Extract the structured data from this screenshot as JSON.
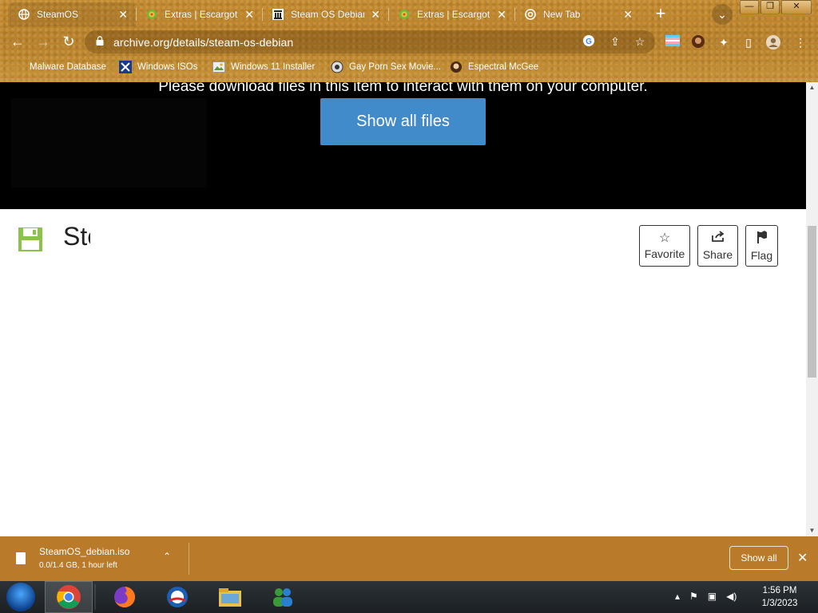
{
  "browser": {
    "tabs": [
      {
        "title": "SteamOS",
        "active": true,
        "icon": "globe-icon"
      },
      {
        "title": "Extras | Escargot",
        "active": false,
        "icon": "escargot-icon"
      },
      {
        "title": "Steam OS Debian",
        "active": false,
        "icon": "archive-icon"
      },
      {
        "title": "Extras | Escargot",
        "active": false,
        "icon": "escargot-icon"
      },
      {
        "title": "New Tab",
        "active": false,
        "icon": "chrome-icon"
      }
    ],
    "new_tab_label": "+",
    "url": "archive.org/details/steam-os-debian",
    "bookmarks": [
      {
        "label": "Malware Database",
        "icon": "folder-icon"
      },
      {
        "label": "Windows ISOs",
        "icon": "x-icon"
      },
      {
        "label": "Windows 11 Installer",
        "icon": "image-icon"
      },
      {
        "label": "Gay Porn Sex Movie...",
        "icon": "site-icon"
      },
      {
        "label": "Espectral McGee",
        "icon": "avatar-icon"
      }
    ]
  },
  "page": {
    "hero_message": "Please download files in this item to interact with them on your computer.",
    "show_all_files_label": "Show all files",
    "item_title": "SteamOS",
    "actions": {
      "favorite": "Favorite",
      "share": "Share",
      "flag": "Flag"
    }
  },
  "download_bar": {
    "filename": "SteamOS_debian.iso",
    "status": "0.0/1.4 GB, 1 hour left",
    "show_all_label": "Show all"
  },
  "taskbar": {
    "apps": [
      "chrome-icon",
      "firefox-icon",
      "obama-icon",
      "explorer-icon",
      "messenger-icon"
    ],
    "time": "1:56 PM",
    "date": "1/3/2023"
  },
  "colors": {
    "chrome_bg": "#c48a2e",
    "download_bar": "#b97a2a",
    "primary_button": "#428bca",
    "floppy_icon": "#8bc34a"
  }
}
